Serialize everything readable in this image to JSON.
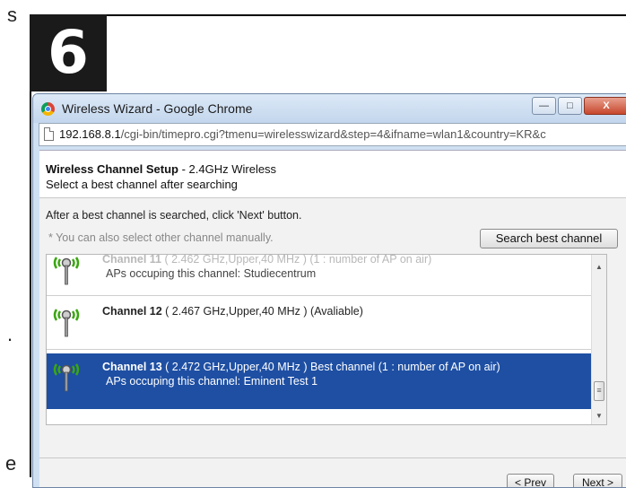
{
  "page": {
    "step_number": "6",
    "margin_letters": [
      "s",
      ".",
      "e"
    ]
  },
  "window": {
    "title": "Wireless Wizard - Google Chrome",
    "controls": {
      "minimize": "—",
      "maximize": "□",
      "close": "X"
    }
  },
  "address": {
    "host": "192.168.8.1",
    "path": "/cgi-bin/timepro.cgi?tmenu=wirelesswizard&step=4&ifname=wlan1&country=KR&c"
  },
  "wizard": {
    "title_bold": "Wireless Channel Setup",
    "title_rest": " - 2.4GHz Wireless",
    "subtitle": "Select a best channel after searching",
    "instruction": "After a best channel is searched, click 'Next' button.",
    "note": "* You can also select other channel manually.",
    "search_button": "Search best channel",
    "channels": [
      {
        "name": "Channel 11",
        "details": " ( 2.462 GHz,Upper,40 MHz )  (1 : number of AP on air)",
        "aps": "APs occuping this channel: Studiecentrum",
        "selected": false
      },
      {
        "name": "Channel 12",
        "details": " ( 2.467 GHz,Upper,40 MHz )  (Avaliable)",
        "aps": "",
        "selected": false
      },
      {
        "name": "Channel 13",
        "details": " ( 2.472 GHz,Upper,40 MHz )  Best channel  (1 : number of AP on air)",
        "aps": "APs occuping this channel: Eminent Test 1",
        "selected": true
      }
    ],
    "prev_button": "< Prev",
    "next_button": "Next >"
  },
  "colors": {
    "selection": "#1e4fa3",
    "ap_icon_waves": "#3aa611"
  }
}
